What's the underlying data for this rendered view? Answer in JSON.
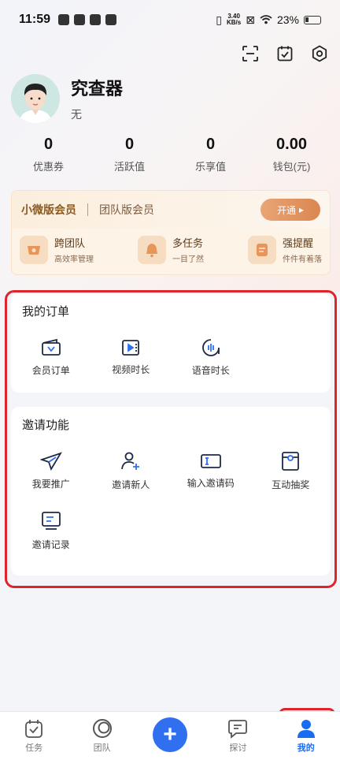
{
  "status_bar": {
    "time": "11:59",
    "net_speed_value": "3.40",
    "net_speed_unit": "KB/s",
    "battery": "23%"
  },
  "profile": {
    "name": "究查器",
    "subtitle": "无"
  },
  "stats": [
    {
      "value": "0",
      "label": "优惠券"
    },
    {
      "value": "0",
      "label": "活跃值"
    },
    {
      "value": "0",
      "label": "乐享值"
    },
    {
      "value": "0.00",
      "label": "钱包(元)"
    }
  ],
  "member": {
    "tab_active": "小微版会员",
    "tab_other": "团队版会员",
    "open_label": "开通",
    "features": [
      {
        "title": "跨团队",
        "desc": "高效率管理",
        "icon": "eye-icon"
      },
      {
        "title": "多任务",
        "desc": "一目了然",
        "icon": "bell-icon"
      },
      {
        "title": "强提醒",
        "desc": "件件有着落",
        "icon": "note-icon"
      }
    ]
  },
  "orders": {
    "title": "我的订单",
    "items": [
      {
        "label": "会员订单",
        "icon": "wallet-icon"
      },
      {
        "label": "视频时长",
        "icon": "video-icon"
      },
      {
        "label": "语音时长",
        "icon": "voice-icon"
      }
    ]
  },
  "invite": {
    "title": "邀请功能",
    "items": [
      {
        "label": "我要推广",
        "icon": "send-icon"
      },
      {
        "label": "邀请新人",
        "icon": "add-user-icon"
      },
      {
        "label": "输入邀请码",
        "icon": "input-code-icon"
      },
      {
        "label": "互动抽奖",
        "icon": "lottery-icon"
      },
      {
        "label": "邀请记录",
        "icon": "record-icon"
      }
    ]
  },
  "nav": [
    {
      "label": "任务",
      "icon": "task-icon"
    },
    {
      "label": "团队",
      "icon": "team-icon"
    },
    {
      "label": "",
      "icon": "plus-icon"
    },
    {
      "label": "探讨",
      "icon": "chat-icon"
    },
    {
      "label": "我的",
      "icon": "person-icon"
    }
  ],
  "colors": {
    "accent": "#1a6cf3",
    "highlight": "#e0242b",
    "member_gold": "#db8650"
  }
}
